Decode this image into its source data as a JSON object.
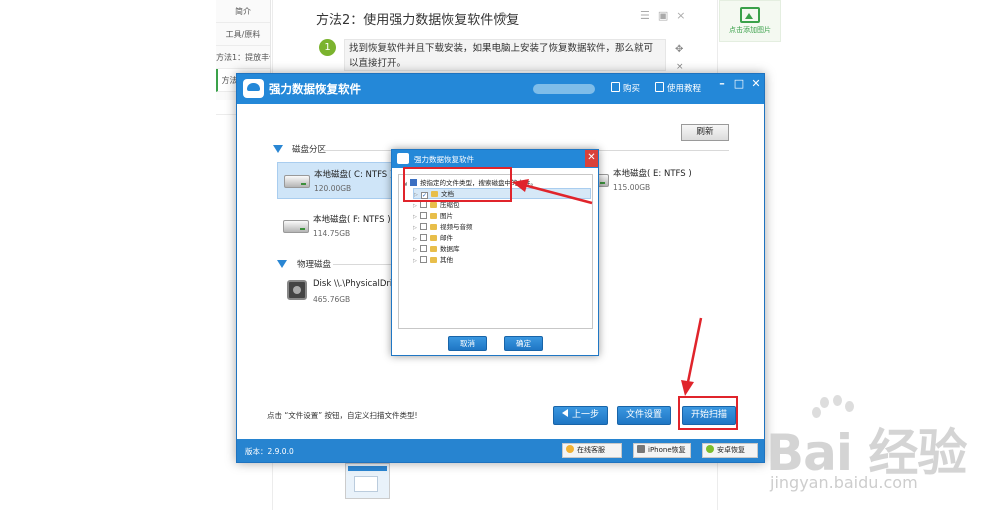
{
  "background": {
    "nav_items": [
      "简介",
      "工具/原料",
      "方法1：提放丰保",
      "方法2：使用",
      "3"
    ],
    "step_title": "方法2：使用强力数据恢复软件恢复",
    "step_number": "1",
    "step_text": "找到恢复软件并且下载安装，如果电脑上安装了恢复数据软件，那么就可以直接打开。",
    "add_image_label": "点击添加图片",
    "close_glyph": "×"
  },
  "app": {
    "title": "强力数据恢复软件",
    "buy_label": "购买",
    "guide_label": "使用教程",
    "refresh_label": "刷新",
    "partition_header": "磁盘分区",
    "physical_header": "物理磁盘",
    "disks": [
      {
        "name": "本地磁盘( C: NTFS )",
        "size": "120.00GB"
      },
      {
        "name": "本地磁盘( E: NTFS )",
        "size": "115.00GB"
      },
      {
        "name": "本地磁盘( F: NTFS )",
        "size": "114.75GB"
      }
    ],
    "physical_disk": {
      "name": "Disk \\\\.\\PhysicalDrive",
      "size": "465.76GB"
    },
    "hint": "点击 “文件设置” 按钮，自定义扫描文件类型!",
    "prev_label": "上一步",
    "file_settings_label": "文件设置",
    "start_scan_label": "开始扫描",
    "version": "版本：2.9.0.0",
    "footer_buttons": [
      "在线客服",
      "iPhone恢复",
      "安卓恢复"
    ]
  },
  "dialog": {
    "title": "强力数据恢复软件",
    "root_label": "按指定的文件类型，搜索磁盘中的文件。",
    "items": [
      "文档",
      "压缩包",
      "图片",
      "视频与音频",
      "邮件",
      "数据库",
      "其他"
    ],
    "cancel_label": "取消",
    "ok_label": "确定"
  },
  "watermark": {
    "brand": "Bai 经验",
    "url": "jingyan.baidu.com"
  },
  "colors": {
    "primary_blue": "#2488d8",
    "annotation_red": "#e0242b",
    "selection_blue": "#cfe5f8"
  }
}
